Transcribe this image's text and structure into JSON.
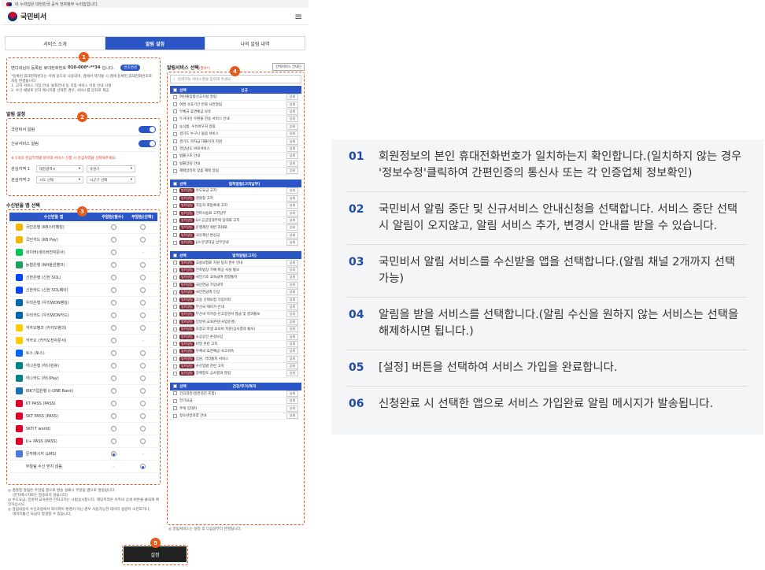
{
  "gov_banner": "이 누리집은 대한민국 공식 전자정부 누리집입니다.",
  "app_title": "국민비서",
  "tabs": [
    {
      "label": "서비스 소개"
    },
    {
      "label": "알림 설정"
    },
    {
      "label": "나의 알림 내역"
    }
  ],
  "badges": [
    "1",
    "2",
    "3",
    "4",
    "5"
  ],
  "phone_info": {
    "prefix": "변디네님의 등록된 휴대전화번호 ",
    "number": "010-000*-**34",
    "suffix": " 입니다.",
    "change_button": "번호변경",
    "notes": [
      "*등록된 휴대전화번호는 아래 용도로 사용되며, 앱에서 제거될 시 앱에 등록된 휴대전화번호로 자동 변경됩니다.",
      "1. 고지 서비스 가입 안내, 탈퇴안내 등 각종 서비스 이용 안내 사항",
      "2. 수신 채널로 문자 메시지를 선택한 경우, 서비스를 문자로 제공"
    ]
  },
  "alarm_settings": {
    "title": "알림 설정",
    "items": [
      {
        "label": "국민비서 알림"
      },
      {
        "label": "신규서비스 알림"
      }
    ],
    "interest_note": "※ 1개의 관심지역별 분야의 서비스 신청 시 관심지역을 선택해주세요.",
    "regions": [
      {
        "label": "관심지역 1",
        "sido": "대전광역시",
        "sigungu": "유성구"
      },
      {
        "label": "관심지역 2",
        "sido": "시도 선택",
        "sigungu": "시군구 선택"
      }
    ]
  },
  "app_select": {
    "title": "수신받을 앱 선택",
    "columns": [
      "수신받을 앱",
      "주알림(필수)",
      "부알림(선택)"
    ],
    "apps": [
      {
        "name": "국민은행 (KB스타뱅킹)",
        "color": "#f7b500",
        "primary": "off",
        "secondary": "off"
      },
      {
        "name": "국민카드 (KB Pay)",
        "color": "#f7b500",
        "primary": "off",
        "secondary": "off"
      },
      {
        "name": "네이버(네이버전자문서)",
        "color": "#03c75a",
        "primary": "off",
        "secondary": "dash"
      },
      {
        "name": "농협은행 (NH올원뱅크)",
        "color": "#1ba160",
        "primary": "off",
        "secondary": "off"
      },
      {
        "name": "신한은행 (신한 SOL)",
        "color": "#0046ff",
        "primary": "off",
        "secondary": "off"
      },
      {
        "name": "신한카드 (신한 SOL페이)",
        "color": "#0046ff",
        "primary": "off",
        "secondary": "off"
      },
      {
        "name": "우리은행 (우리WON뱅킹)",
        "color": "#0067ac",
        "primary": "off",
        "secondary": "off"
      },
      {
        "name": "우리카드 (우리WON카드)",
        "color": "#0067ac",
        "primary": "off",
        "secondary": "off"
      },
      {
        "name": "카카오뱅크 (카카오뱅크)",
        "color": "#ffcd00",
        "primary": "off",
        "secondary": "off"
      },
      {
        "name": "카카오 (카카오전자문서)",
        "color": "#ffcd00",
        "primary": "off",
        "secondary": "dash"
      },
      {
        "name": "토스 (토스)",
        "color": "#0064ff",
        "primary": "off",
        "secondary": "off"
      },
      {
        "name": "하나은행 (하나원큐)",
        "color": "#008485",
        "primary": "off",
        "secondary": "off"
      },
      {
        "name": "하나카드 (하나Pay)",
        "color": "#008485",
        "primary": "off",
        "secondary": "off"
      },
      {
        "name": "IBK기업은행 (i-ONE Bank)",
        "color": "#1b6fb5",
        "primary": "off",
        "secondary": "off"
      },
      {
        "name": "KT PASS (PASS)",
        "color": "#e4002b",
        "primary": "off",
        "secondary": "off"
      },
      {
        "name": "SKT PASS (PASS)",
        "color": "#e4002b",
        "primary": "off",
        "secondary": "off"
      },
      {
        "name": "SKT(T world)",
        "color": "#e4002b",
        "primary": "off",
        "secondary": "off"
      },
      {
        "name": "U+ PASS (PASS)",
        "color": "#e4002b",
        "primary": "off",
        "secondary": "off"
      },
      {
        "name": "문자메시지 (LMS)",
        "color": "#4a7bd6",
        "primary": "on",
        "secondary": "dash"
      },
      {
        "name": "부알림 수신 받지 않음",
        "color": "",
        "primary": "dash",
        "secondary": "on"
      }
    ],
    "notes": [
      "◎ 경찰청 알림은 주알림 앱으로 발송 실패시 부알림 앱으로 발송됩니다.",
      "(문자메시지로는 발송되지 않습니다)",
      "◎ 수도요금, 민방위 교육훈련 전자고지는 시범실시합니다. 해당지역은 우측의 상세 버튼을 클릭해 확인하십시오.",
      "◎ 알림내용이 수신과정에서 외이파이 환경이 아닌 경우 사용가능한 데이터 용량이 소진되거나,",
      "데이터통신 요금이 발생할 수 있습니다."
    ]
  },
  "svc_select": {
    "title": "알림서비스 선택",
    "title_tag": "(필수*)",
    "guide_button": "선택서비스 안내단",
    "search_placeholder": "검색하실 서비스명을 입력해 주세요.",
    "detail_label": "상세",
    "select_label": "선택",
    "groups": [
      {
        "name": "신규",
        "items": [
          {
            "tag": "",
            "label": "여선출입항신고사실 알림"
          },
          {
            "tag": "",
            "label": "여권 유효기간 만료 사전알림"
          },
          {
            "tag": "",
            "label": "무체국 휴면예금 보유"
          },
          {
            "tag": "",
            "label": "두거이인 우편물 전송 서비스 안내"
          },
          {
            "tag": "",
            "label": "농식품, 우유바우처 알림"
          },
          {
            "tag": "",
            "label": "경기도 누구나 돌봄 서비스"
          },
          {
            "tag": "",
            "label": "경기도 학자금 대출이자 지원"
          },
          {
            "tag": "",
            "label": "경상남도 바로서비스"
          },
          {
            "tag": "",
            "label": "법률구조 안내"
          },
          {
            "tag": "",
            "label": "법률상담 안내"
          },
          {
            "tag": "",
            "label": "혜택알리미 맞춤 혜택 알림"
          }
        ]
      },
      {
        "name": "법적알림(고지납부)",
        "items": [
          {
            "tag": "법적알림",
            "label": "수도요금 고지"
          },
          {
            "tag": "법적알림",
            "label": "경찰청 고지"
          },
          {
            "tag": "법적알림",
            "label": "자동차 최등록세 고지"
          },
          {
            "tag": "법적알림",
            "label": "전파사용료 고지납부"
          },
          {
            "tag": "법적알림",
            "label": "LH 공공임대주택 임대료 고지"
          },
          {
            "tag": "법적알림",
            "label": "운행제한 위반 과태료"
          },
          {
            "tag": "법적알림",
            "label": "국유재산 변상금"
          },
          {
            "tag": "법적알림",
            "label": "LH 분양대금 납부안내"
          }
        ]
      },
      {
        "name": "법적알림(고지)",
        "items": [
          {
            "tag": "법적알림",
            "label": "고용보험료 지원 등지 권수 안내"
          },
          {
            "tag": "법적알림",
            "label": "건축법상 가예 제공 사실 통보"
          },
          {
            "tag": "법적알림",
            "label": "국민기초 교육급여 결정통지"
          },
          {
            "tag": "법적알림",
            "label": "국민연금 가입내역"
          },
          {
            "tag": "법적알림",
            "label": "국민연금액 인상"
          },
          {
            "tag": "법적알림",
            "label": "고용 선제보험 가입이력"
          },
          {
            "tag": "법적알림",
            "label": "무선국 재허가 안내"
          },
          {
            "tag": "법적알림",
            "label": "무선국 허가증·신고증명서 발급 및 결과통보"
          },
          {
            "tag": "법적알림",
            "label": "민방위 교육훈련(사업운영)"
          },
          {
            "tag": "법적알림",
            "label": "초중고 학생 교육비 지원(심사결과 통보)"
          },
          {
            "tag": "법적알림",
            "label": "소상공인 손실보상"
          },
          {
            "tag": "법적알림",
            "label": "비밀 관련 고지"
          },
          {
            "tag": "법적알림",
            "label": "우체국 휴면예금 국고귀속"
          },
          {
            "tag": "법적알림",
            "label": "입원, 격리통지 서비스"
          },
          {
            "tag": "법적알림",
            "label": "수산업법 관련 고지"
          },
          {
            "tag": "법적알림",
            "label": "장애정도 심사결과 알림"
          }
        ]
      },
      {
        "name": "건강/주거/복지",
        "items": [
          {
            "tag": "",
            "label": "건강검진(일반검진 포함)"
          },
          {
            "tag": "",
            "label": "전기요금"
          },
          {
            "tag": "",
            "label": "주택 임대차"
          },
          {
            "tag": "",
            "label": "청소년방과후 안내"
          }
        ]
      }
    ],
    "footer_note": "◎ 알림서비스는 설정 후 다음날부터 반영됩니다."
  },
  "set_button": "설정",
  "steps": [
    {
      "no": "01",
      "text": "회원정보의 본인 휴대전화번호가 일치하는지 확인합니다.(일치하지 않는 경우 '정보수정'클릭하여 간편인증의 통신사 또는 각 인증업체 정보확인)"
    },
    {
      "no": "02",
      "text": "국민비서 알림 중단 및 신규서비스 안내신청을 선택합니다. 서비스 중단 선택시 알림이 오지않고, 알림 서비스 추가, 변경시 안내를 받을 수 있습니다."
    },
    {
      "no": "03",
      "text": "국민비서 알림 서비스를 수신받을 앱을 선택합니다.(알림 채널 2개까지 선택 가능)"
    },
    {
      "no": "04",
      "text": "알림을 받을 서비스를 선택합니다.(알림 수신을 원하지 않는 서비스는 선택을 해제하시면 됩니다.)"
    },
    {
      "no": "05",
      "text": "[설정] 버튼을 선택하여 서비스 가입을 완료합니다."
    },
    {
      "no": "06",
      "text": "신청완료 시 선택한 앱으로 서비스 가입완료 알림 메시지가 발송됩니다."
    }
  ]
}
